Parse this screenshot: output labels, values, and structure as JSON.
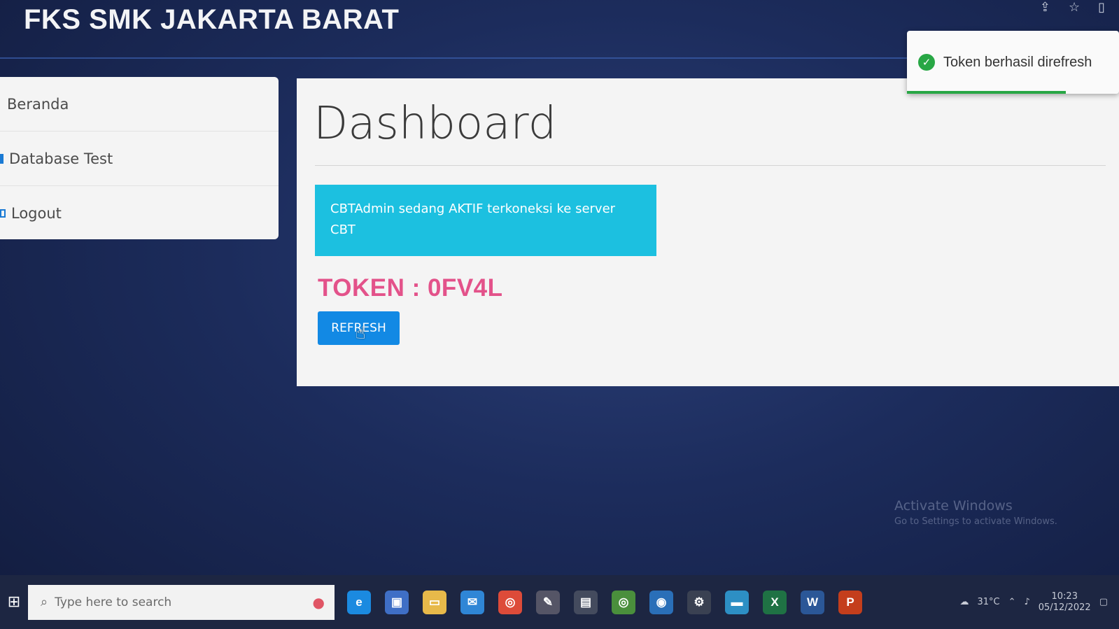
{
  "app": {
    "title": "FKS SMK JAKARTA BARAT"
  },
  "sidebar": {
    "items": [
      {
        "label": "Beranda"
      },
      {
        "label": "Database Test"
      },
      {
        "label": "Logout"
      }
    ]
  },
  "main": {
    "title": "Dashboard",
    "status_message": "CBTAdmin sedang AKTIF terkoneksi ke server CBT",
    "token_text": "TOKEN : 0FV4L",
    "refresh_label": "REFRESH"
  },
  "toast": {
    "message": "Token berhasil direfresh"
  },
  "watermark": {
    "line1": "Activate Windows",
    "line2": "Go to Settings to activate Windows."
  },
  "taskbar": {
    "search_placeholder": "Type here to search",
    "temperature": "31°C",
    "time": "10:23",
    "date": "05/12/2022"
  },
  "colors": {
    "accent": "#1289e4",
    "alert": "#1cc0e0",
    "token": "#e3528a",
    "success": "#28a745"
  },
  "icons": [
    "windows-start-icon",
    "search-icon",
    "edge-icon",
    "store-icon",
    "explorer-icon",
    "mail-icon",
    "chrome-icon",
    "settings-icon",
    "word-icon",
    "powerpoint-icon"
  ]
}
